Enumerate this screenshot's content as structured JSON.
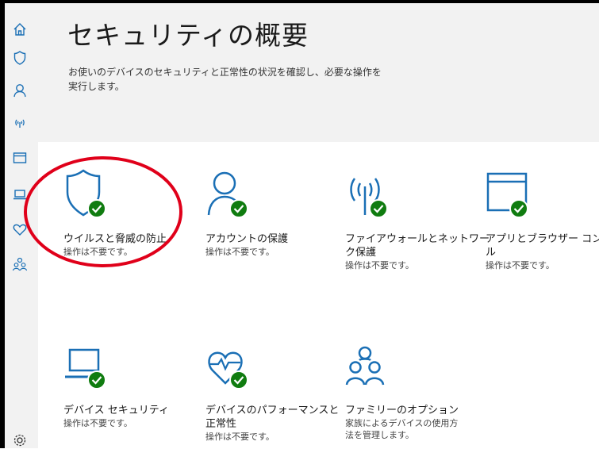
{
  "header": {
    "title": "セキュリティの概要",
    "subtitle": "お使いのデバイスのセキュリティと正常性の状況を確認し、必要な操作を実行します。"
  },
  "sidebar": {
    "items": [
      {
        "icon": "home-icon"
      },
      {
        "icon": "shield-icon"
      },
      {
        "icon": "person-icon"
      },
      {
        "icon": "wireless-icon"
      },
      {
        "icon": "app-browser-icon"
      },
      {
        "icon": "laptop-icon"
      },
      {
        "icon": "heart-icon"
      },
      {
        "icon": "family-icon"
      },
      {
        "icon": "gear-icon"
      }
    ]
  },
  "tiles": [
    {
      "icon": "shield-check-icon",
      "title": "ウイルスと脅威の防止",
      "status": "操作は不要です。"
    },
    {
      "icon": "account-check-icon",
      "title": "アカウントの保護",
      "status": "操作は不要です。"
    },
    {
      "icon": "firewall-check-icon",
      "title_line1": "ファイアウォールとネットワー",
      "title_line2": "ク保護",
      "status": "操作は不要です。"
    },
    {
      "icon": "app-browser-check-icon",
      "title_line1": "アプリとブラウザー コントロー",
      "title_line2": "ル",
      "status": "操作は不要です。"
    },
    {
      "icon": "device-security-check-icon",
      "title": "デバイス セキュリティ",
      "status": "操作は不要です。"
    },
    {
      "icon": "device-performance-check-icon",
      "title_line1": "デバイスのパフォーマンスと",
      "title_line2": "正常性",
      "status": "操作は不要です。"
    },
    {
      "icon": "family-options-icon",
      "title": "ファミリーのオプション",
      "status_line1": "家族によるデバイスの使用方",
      "status_line2": "法を管理します。"
    }
  ],
  "colors": {
    "accent": "#1a6fb5",
    "check": "#107c10",
    "highlight_ring": "#e0001a",
    "header_bg": "#f2f2f2"
  }
}
